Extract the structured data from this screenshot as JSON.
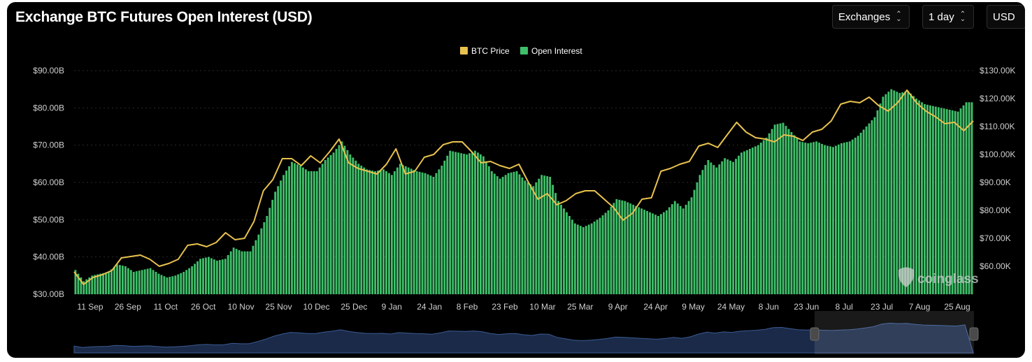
{
  "title": "Exchange BTC Futures Open Interest (USD)",
  "controls": {
    "exchanges": "Exchanges",
    "interval": "1 day",
    "currency": "USD"
  },
  "watermark": "coinglass",
  "colors": {
    "background": "#000000",
    "open_interest": "#3fbf6a",
    "btc_price": "#e8c24f",
    "grid": "#2a2a2a",
    "navigator": "#2f4a7a"
  },
  "chart_data": {
    "type": "bar",
    "legend": [
      {
        "name": "BTC Price",
        "color": "#e8c24f",
        "type": "line"
      },
      {
        "name": "Open Interest",
        "color": "#3fbf6a",
        "type": "bar"
      }
    ],
    "legend_position": "top-center",
    "y_left": {
      "ticks": [
        "$90.00B",
        "$80.00B",
        "$70.00B",
        "$60.00B",
        "$50.00B",
        "$40.00B",
        "$30.00B"
      ],
      "range": [
        30,
        90
      ],
      "unit": "B USD"
    },
    "y_right": {
      "ticks": [
        "$130.00K",
        "$120.00K",
        "$110.00K",
        "$100.00K",
        "$90.00K",
        "$80.00K",
        "$70.00K",
        "$60.00K"
      ],
      "range": [
        50,
        130
      ],
      "unit": "K USD"
    },
    "x_ticks": [
      "11 Sep",
      "26 Sep",
      "11 Oct",
      "26 Oct",
      "10 Nov",
      "25 Nov",
      "10 Dec",
      "25 Dec",
      "9 Jan",
      "24 Jan",
      "8 Feb",
      "23 Feb",
      "10 Mar",
      "25 Mar",
      "9 Apr",
      "24 Apr",
      "9 May",
      "24 May",
      "8 Jun",
      "23 Jun",
      "8 Jul",
      "23 Jul",
      "7 Aug",
      "25 Aug"
    ],
    "grid": true,
    "series": [
      {
        "name": "Open Interest",
        "axis": "left",
        "sampled_every_days": 3,
        "values": [
          36.5,
          33.5,
          35.0,
          35.5,
          36.0,
          38.0,
          37.5,
          36.0,
          36.5,
          37.0,
          35.5,
          34.5,
          35.0,
          36.0,
          37.5,
          39.5,
          40.0,
          39.0,
          39.5,
          42.5,
          41.5,
          41.5,
          46.0,
          51.0,
          57.5,
          62.0,
          65.5,
          64.5,
          63.0,
          63.0,
          66.0,
          68.0,
          71.0,
          67.5,
          65.0,
          63.5,
          63.0,
          63.5,
          62.0,
          65.0,
          64.0,
          63.0,
          62.5,
          61.5,
          64.5,
          68.5,
          68.0,
          67.5,
          68.5,
          67.0,
          63.0,
          61.0,
          62.5,
          63.0,
          60.5,
          59.0,
          62.0,
          61.5,
          55.0,
          52.0,
          49.0,
          48.0,
          49.0,
          50.5,
          52.5,
          55.5,
          55.0,
          54.0,
          53.0,
          52.0,
          51.0,
          52.5,
          55.0,
          53.0,
          56.0,
          62.0,
          66.0,
          64.0,
          66.5,
          65.5,
          68.0,
          69.0,
          70.0,
          72.0,
          75.5,
          76.0,
          73.5,
          71.0,
          70.5,
          71.0,
          70.0,
          69.5,
          70.5,
          71.0,
          72.5,
          75.0,
          77.5,
          83.0,
          85.0,
          84.0,
          84.5,
          82.5,
          81.0,
          80.5,
          80.0,
          79.5,
          79.0,
          81.5
        ]
      },
      {
        "name": "BTC Price",
        "axis": "right",
        "sampled_every_days": 3,
        "values": [
          58.0,
          53.5,
          56.0,
          57.0,
          58.5,
          63.0,
          63.5,
          64.0,
          62.5,
          60.0,
          61.0,
          62.5,
          67.5,
          68.0,
          67.0,
          68.5,
          72.0,
          69.5,
          70.0,
          76.0,
          87.0,
          91.0,
          98.5,
          98.5,
          96.0,
          99.5,
          97.0,
          101.0,
          105.5,
          97.0,
          95.0,
          94.0,
          93.0,
          96.5,
          102.0,
          93.0,
          94.0,
          99.0,
          100.0,
          103.5,
          104.5,
          104.5,
          101.0,
          97.0,
          97.5,
          96.0,
          95.0,
          96.5,
          90.0,
          84.0,
          86.0,
          82.0,
          83.5,
          86.0,
          87.0,
          87.0,
          84.0,
          81.0,
          76.5,
          79.0,
          84.0,
          84.5,
          94.0,
          95.0,
          96.5,
          97.5,
          103.0,
          104.0,
          102.5,
          107.0,
          111.5,
          108.0,
          106.0,
          105.5,
          104.5,
          107.0,
          106.5,
          105.0,
          108.0,
          109.0,
          112.0,
          118.0,
          119.0,
          118.5,
          120.5,
          117.5,
          115.5,
          118.5,
          123.0,
          118.5,
          115.5,
          113.5,
          111.0,
          111.5,
          108.5,
          112.0
        ]
      }
    ],
    "navigator": {
      "selected_range": "8 Jul – 25 Aug"
    }
  }
}
